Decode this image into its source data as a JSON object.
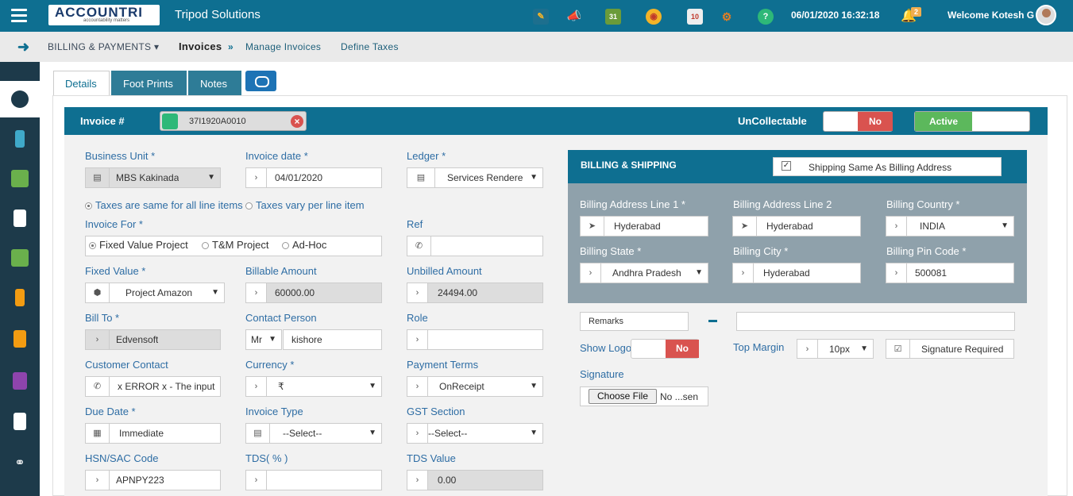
{
  "header": {
    "logo_text": "ACCOUNTRI",
    "logo_sub": "accountability matters",
    "company": "Tripod Solutions",
    "datetime": "06/01/2020 16:32:18",
    "notif_count": "2",
    "welcome": "Welcome Kotesh G"
  },
  "breadcrumb": {
    "module": "BILLING & PAYMENTS",
    "current": "Invoices",
    "link1": "Manage Invoices",
    "link2": "Define Taxes"
  },
  "tabs": [
    {
      "label": "Details"
    },
    {
      "label": "Foot Prints"
    },
    {
      "label": "Notes"
    }
  ],
  "invoice": {
    "label": "Invoice #",
    "number": "37I1920A0010",
    "uncollectable_label": "UnCollectable",
    "uncollectable_value": "No",
    "status": "Active"
  },
  "fields": {
    "business_unit": {
      "label": "Business Unit *",
      "value": "MBS Kakinada"
    },
    "invoice_date": {
      "label": "Invoice date *",
      "value": "04/01/2020"
    },
    "ledger": {
      "label": "Ledger *",
      "value": "Services Rendere"
    },
    "tax_same": "Taxes are same for all line items",
    "tax_vary": "Taxes vary per line item",
    "invoice_for": {
      "label": "Invoice For *",
      "opt1": "Fixed Value Project",
      "opt2": "T&M Project",
      "opt3": "Ad-Hoc"
    },
    "ref": {
      "label": "Ref",
      "value": ""
    },
    "fixed_value": {
      "label": "Fixed Value *",
      "value": "Project Amazon"
    },
    "billable": {
      "label": "Billable Amount",
      "value": "60000.00"
    },
    "unbilled": {
      "label": "Unbilled Amount",
      "value": "24494.00"
    },
    "bill_to": {
      "label": "Bill To *",
      "value": "Edvensoft"
    },
    "contact_person": {
      "label": "Contact Person",
      "title": "Mr",
      "value": "kishore"
    },
    "role": {
      "label": "Role",
      "value": ""
    },
    "customer_contact": {
      "label": "Customer Contact",
      "value": "x ERROR x - The input"
    },
    "currency": {
      "label": "Currency *",
      "value": "₹"
    },
    "payment_terms": {
      "label": "Payment Terms",
      "value": "OnReceipt"
    },
    "due_date": {
      "label": "Due Date *",
      "value": "Immediate"
    },
    "invoice_type": {
      "label": "Invoice Type",
      "value": "--Select--"
    },
    "gst_section": {
      "label": "GST Section",
      "value": "--Select--"
    },
    "hsn": {
      "label": "HSN/SAC Code",
      "value": "APNPY223"
    },
    "tds": {
      "label": "TDS( % )",
      "value": ""
    },
    "tds_value": {
      "label": "TDS Value",
      "value": "0.00"
    }
  },
  "billing": {
    "title": "BILLING & SHIPPING",
    "same_label": "Shipping Same As Billing Address",
    "line1": {
      "label": "Billing Address Line 1 *",
      "value": "Hyderabad"
    },
    "line2": {
      "label": "Billing Address Line 2",
      "value": "Hyderabad"
    },
    "country": {
      "label": "Billing Country *",
      "value": "INDIA"
    },
    "state": {
      "label": "Billing State *",
      "value": "Andhra Pradesh"
    },
    "city": {
      "label": "Billing City *",
      "value": "Hyderabad"
    },
    "pin": {
      "label": "Billing Pin Code *",
      "value": "500081"
    }
  },
  "extra": {
    "remarks": "Remarks",
    "show_logo": "Show Logo",
    "show_logo_value": "No",
    "top_margin": "Top Margin",
    "top_margin_value": "10px",
    "signature_required": "Signature Required",
    "signature": "Signature",
    "choose_file": "Choose File",
    "no_file": "No ...sen"
  }
}
